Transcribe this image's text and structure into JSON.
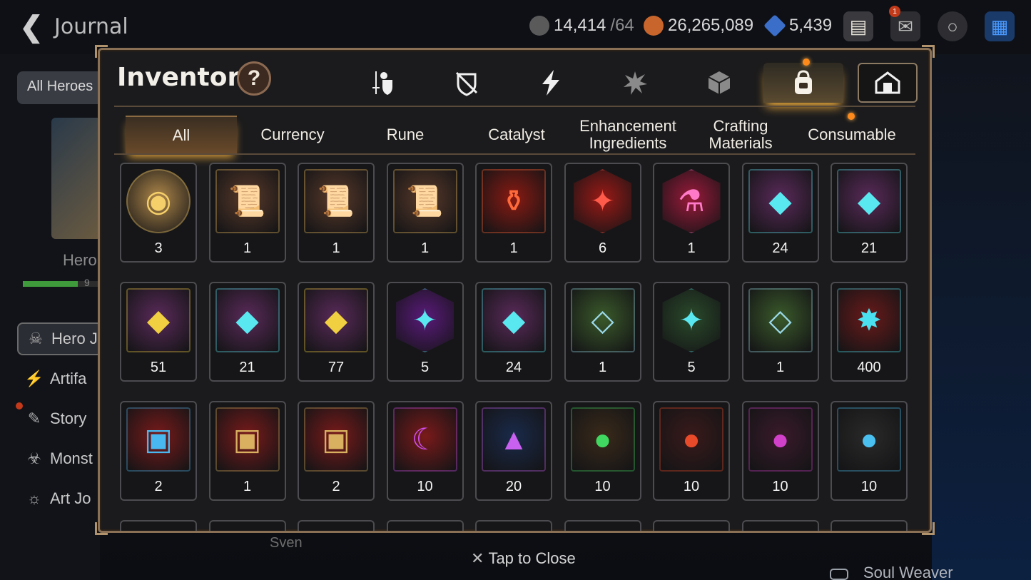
{
  "top_bar": {
    "title": "Journal",
    "resources": [
      {
        "name": "stamina",
        "icon": "stamina-icon",
        "value": "14,414",
        "sub": "/64",
        "color": "#8c8c8c"
      },
      {
        "name": "gold",
        "icon": "gold-coin-icon",
        "value": "26,265,089",
        "color": "#c8652c"
      },
      {
        "name": "skystone",
        "icon": "skystone-icon",
        "value": "5,439",
        "color": "#3a6ec8"
      }
    ],
    "mail_badge": "1"
  },
  "sidebar": {
    "filter": "All Heroes",
    "hero_label": "Hero",
    "progress_text": "9",
    "progress": 0.7,
    "nav": [
      {
        "label": "Hero J",
        "icon": "hero-journal-icon",
        "active": true
      },
      {
        "label": "Artifa",
        "icon": "artifact-icon",
        "active": false
      },
      {
        "label": "Story",
        "icon": "story-icon",
        "active": false
      },
      {
        "label": "Monst",
        "icon": "monster-icon",
        "active": false
      },
      {
        "label": "Art Jo",
        "icon": "art-journal-icon",
        "active": false
      }
    ]
  },
  "background": {
    "sven": "Sven",
    "soul_weaver": "Soul Weaver"
  },
  "modal": {
    "title": "Inventory",
    "help": "?",
    "category_tabs": [
      {
        "icon": "weapon-armor-icon",
        "active": false
      },
      {
        "icon": "shield-broken-icon",
        "active": false
      },
      {
        "icon": "lightning-icon",
        "active": false
      },
      {
        "icon": "splat-icon",
        "active": false
      },
      {
        "icon": "cube-icon",
        "active": false
      },
      {
        "icon": "backpack-icon",
        "active": true
      },
      {
        "icon": "storage-house-icon",
        "active": false
      }
    ],
    "sub_tabs": [
      {
        "label": "All",
        "active": true
      },
      {
        "label": "Currency"
      },
      {
        "label": "Rune"
      },
      {
        "label": "Catalyst"
      },
      {
        "label": "Enhancement Ingredients"
      },
      {
        "label": "Crafting Materials"
      },
      {
        "label": "Consumable"
      }
    ],
    "items": [
      {
        "count": "3",
        "icon": "penguin-icon",
        "shape": "circle",
        "bg": "#b0884a",
        "fg": "#f5d06a",
        "glyph": "◉"
      },
      {
        "count": "1",
        "icon": "rainbow-scroll-icon",
        "shape": "square",
        "bg": "#5a3a2a",
        "fg": "#f0c060",
        "glyph": "📜"
      },
      {
        "count": "1",
        "icon": "scroll-up-icon",
        "shape": "square",
        "bg": "#5a3a2a",
        "fg": "#f0c060",
        "glyph": "📜"
      },
      {
        "count": "1",
        "icon": "dragon-scroll-icon",
        "shape": "square",
        "bg": "#5a3a2a",
        "fg": "#f0c060",
        "glyph": "📜"
      },
      {
        "count": "1",
        "icon": "red-potion-icon",
        "shape": "square",
        "bg": "#8a1a12",
        "fg": "#ff6a3a",
        "glyph": "⚱"
      },
      {
        "count": "6",
        "icon": "red-rune-icon",
        "shape": "hex",
        "bg": "#9a1a16",
        "fg": "#ff5a4a",
        "glyph": "✦"
      },
      {
        "count": "1",
        "icon": "pink-potion-icon",
        "shape": "hex",
        "bg": "#9a1a3a",
        "fg": "#ff7ac8",
        "glyph": "⚗"
      },
      {
        "count": "24",
        "icon": "boot-rune-icon",
        "shape": "square",
        "bg": "#5a2a5a",
        "fg": "#5ae8f0",
        "glyph": "◆"
      },
      {
        "count": "21",
        "icon": "armor-rune-icon",
        "shape": "square",
        "bg": "#5a2a5a",
        "fg": "#5ae8f0",
        "glyph": "◆"
      },
      {
        "count": "51",
        "icon": "gold-rune-icon",
        "shape": "square",
        "bg": "#5a2a5a",
        "fg": "#f0d040",
        "glyph": "◆"
      },
      {
        "count": "21",
        "icon": "swirl-rune-icon",
        "shape": "square",
        "bg": "#5a2a5a",
        "fg": "#5ae8f0",
        "glyph": "◆"
      },
      {
        "count": "77",
        "icon": "hammer-rune-icon",
        "shape": "square",
        "bg": "#5a2a5a",
        "fg": "#f0d040",
        "glyph": "◆"
      },
      {
        "count": "5",
        "icon": "star-rune-icon",
        "shape": "hex",
        "bg": "#5a1a7a",
        "fg": "#5ae8f0",
        "glyph": "✦"
      },
      {
        "count": "24",
        "icon": "sword-rune-icon",
        "shape": "square",
        "bg": "#5a2a5a",
        "fg": "#5ae8f0",
        "glyph": "◆"
      },
      {
        "count": "1",
        "icon": "boot-stone-icon",
        "shape": "square",
        "bg": "#3a5a2a",
        "fg": "#9ad8e8",
        "glyph": "◇"
      },
      {
        "count": "5",
        "icon": "star-stone-icon",
        "shape": "hex",
        "bg": "#2a4a2a",
        "fg": "#5ae8f0",
        "glyph": "✦"
      },
      {
        "count": "1",
        "icon": "sword-stone-icon",
        "shape": "square",
        "bg": "#3a5a2a",
        "fg": "#9ad8e8",
        "glyph": "◇"
      },
      {
        "count": "400",
        "icon": "crystal-shard-icon",
        "shape": "square",
        "bg": "#6a1a1a",
        "fg": "#4ae0f0",
        "glyph": "✸"
      },
      {
        "count": "2",
        "icon": "blue-chest-icon",
        "shape": "square",
        "bg": "#7a1a1a",
        "fg": "#4ab8f0",
        "glyph": "▣"
      },
      {
        "count": "1",
        "icon": "gold-chest-icon",
        "shape": "square",
        "bg": "#7a1a1a",
        "fg": "#d8b060",
        "glyph": "▣"
      },
      {
        "count": "2",
        "icon": "gold-chest-icon",
        "shape": "square",
        "bg": "#7a1a1a",
        "fg": "#d8b060",
        "glyph": "▣"
      },
      {
        "count": "10",
        "icon": "purple-moon-gem-icon",
        "shape": "square",
        "bg": "#7a1a1a",
        "fg": "#d050f0",
        "glyph": "☾"
      },
      {
        "count": "20",
        "icon": "purple-triangle-gem-icon",
        "shape": "square",
        "bg": "#1a2a4a",
        "fg": "#c860f0",
        "glyph": "▲"
      },
      {
        "count": "10",
        "icon": "green-orb-icon",
        "shape": "square",
        "bg": "#3a2a1a",
        "fg": "#40d860",
        "glyph": "●"
      },
      {
        "count": "10",
        "icon": "red-orb-icon",
        "shape": "square",
        "bg": "#3a1a1a",
        "fg": "#e84a2a",
        "glyph": "●"
      },
      {
        "count": "10",
        "icon": "purple-orb-icon",
        "shape": "square",
        "bg": "#3a1a2a",
        "fg": "#d040c8",
        "glyph": "●"
      },
      {
        "count": "10",
        "icon": "blue-orb-icon",
        "shape": "square",
        "bg": "#2a2a2a",
        "fg": "#4ac0f0",
        "glyph": "●"
      }
    ],
    "tap_close": "Tap to Close"
  }
}
